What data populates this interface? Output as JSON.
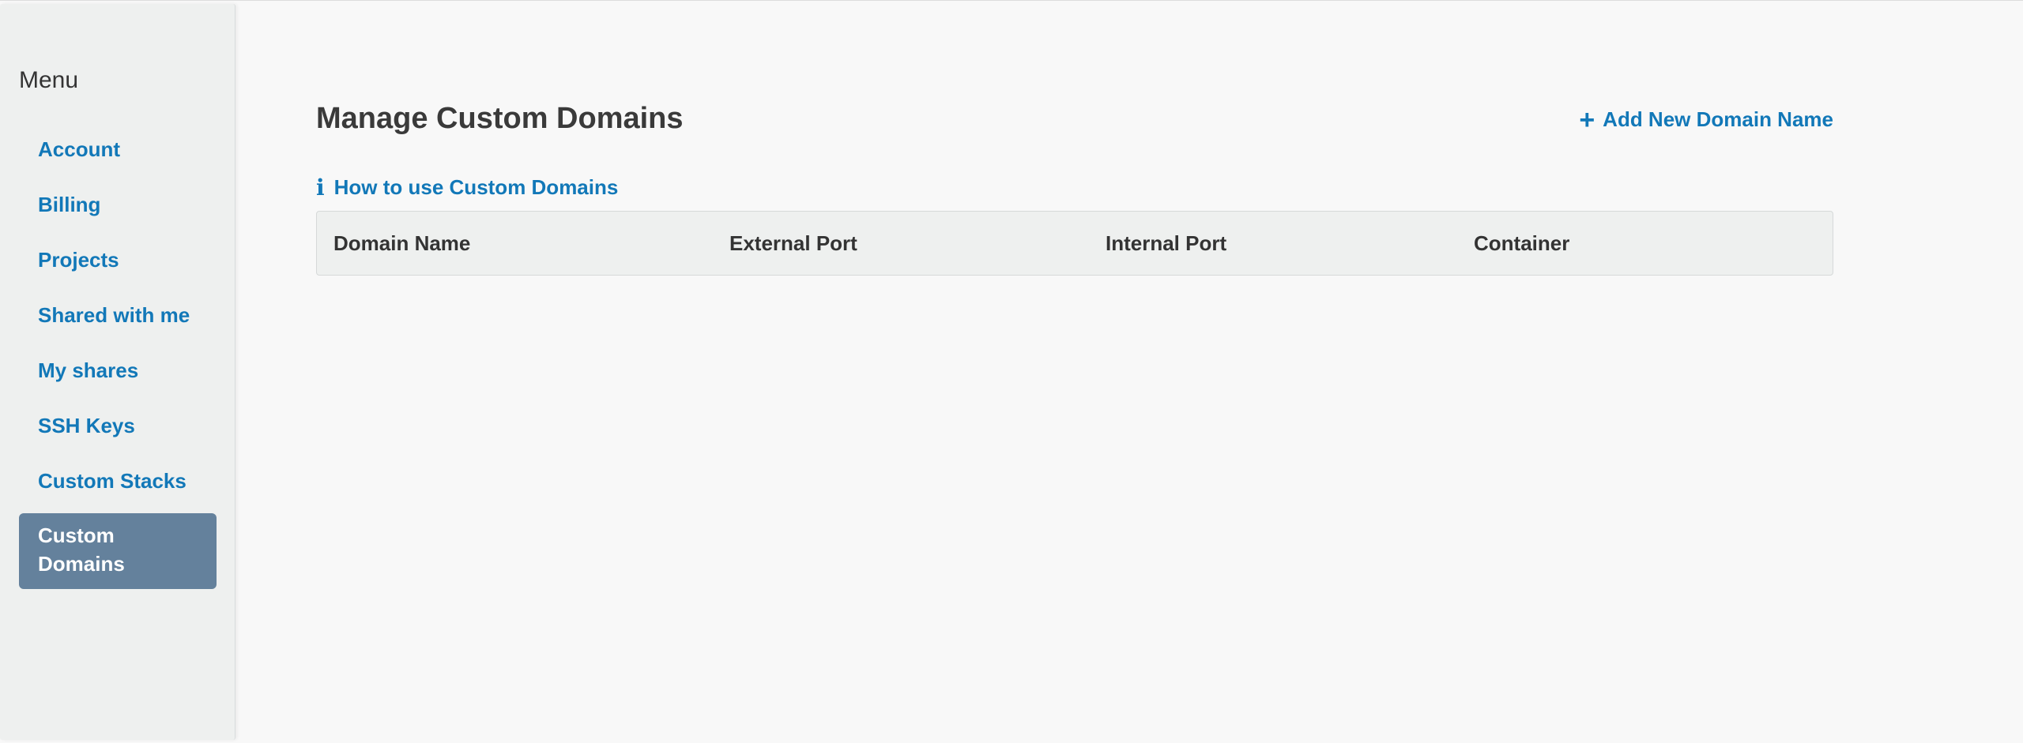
{
  "sidebar": {
    "heading": "Menu",
    "items": [
      {
        "label": "Account",
        "active": false
      },
      {
        "label": "Billing",
        "active": false
      },
      {
        "label": "Projects",
        "active": false
      },
      {
        "label": "Shared with me",
        "active": false
      },
      {
        "label": "My shares",
        "active": false
      },
      {
        "label": "SSH Keys",
        "active": false
      },
      {
        "label": "Custom Stacks",
        "active": false
      },
      {
        "label": "Custom\nDomains",
        "active": true
      }
    ]
  },
  "main": {
    "title": "Manage Custom Domains",
    "add_link": {
      "icon": "plus-icon",
      "label": "Add New Domain Name"
    },
    "howto_link": {
      "icon": "info-icon",
      "label": "How to use Custom Domains"
    },
    "table": {
      "columns": [
        "Domain Name",
        "External Port",
        "Internal Port",
        "Container"
      ],
      "rows": []
    }
  },
  "colors": {
    "link": "#1278b8",
    "active_item_bg": "#64819c",
    "sidebar_bg": "#eef0ef",
    "page_bg": "#f8f8f8"
  }
}
